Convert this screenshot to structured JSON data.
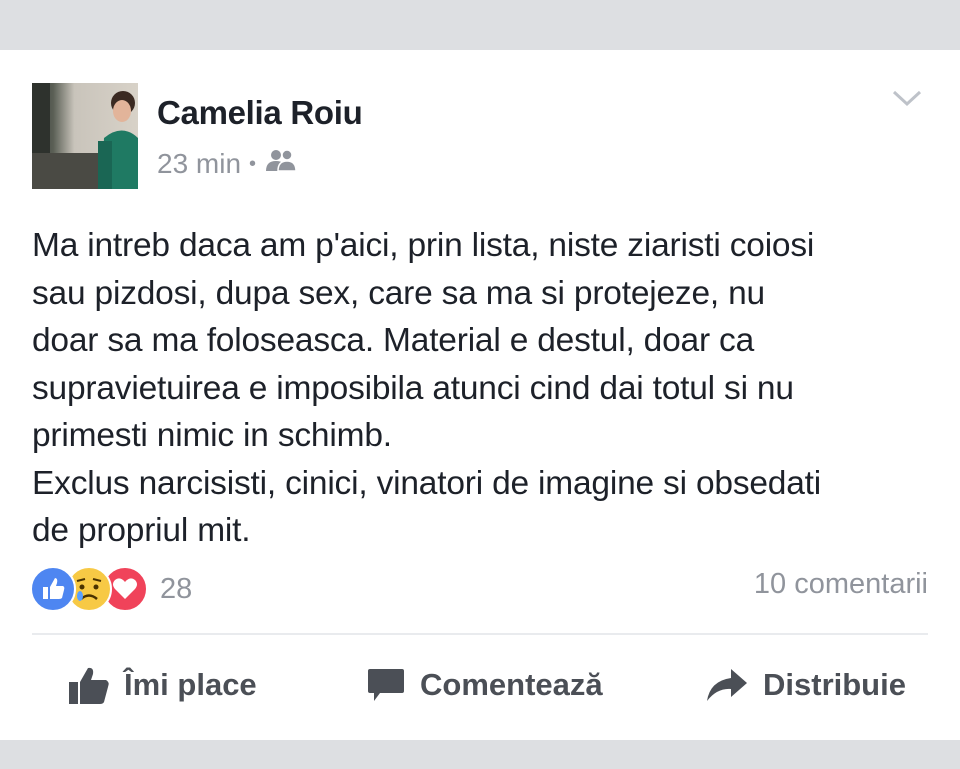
{
  "post": {
    "author": "Camelia Roiu",
    "time": "23 min",
    "separator": "•",
    "audience_icon": "friends-icon",
    "text": "Ma intreb daca am p'aici, prin lista, niste ziaristi coiosi\nsau pizdosi, dupa sex, care sa ma si protejeze,  nu\ndoar sa ma foloseasca. Material e destul, doar ca\nsupravietuirea e imposibila atunci cind dai totul si nu\nprimesti nimic in schimb.\nExclus narcisisti, cinici, vinatori de imagine si obsedati\nde propriul mit.",
    "reactions": {
      "icons": [
        "like-reaction-icon",
        "sad-reaction-icon",
        "love-reaction-icon"
      ],
      "count": "28"
    },
    "comments_label": "10 comentarii"
  },
  "actions": {
    "like_label": "Îmi place",
    "comment_label": "Comentează",
    "share_label": "Distribuie"
  },
  "colors": {
    "background": "#dddfe2",
    "card": "#ffffff",
    "text": "#1d2129",
    "meta": "#90949c",
    "action": "#4b4f56",
    "like_blue": "#4e86f1",
    "love_red": "#f0435a",
    "sad_yellow": "#f7c945"
  }
}
